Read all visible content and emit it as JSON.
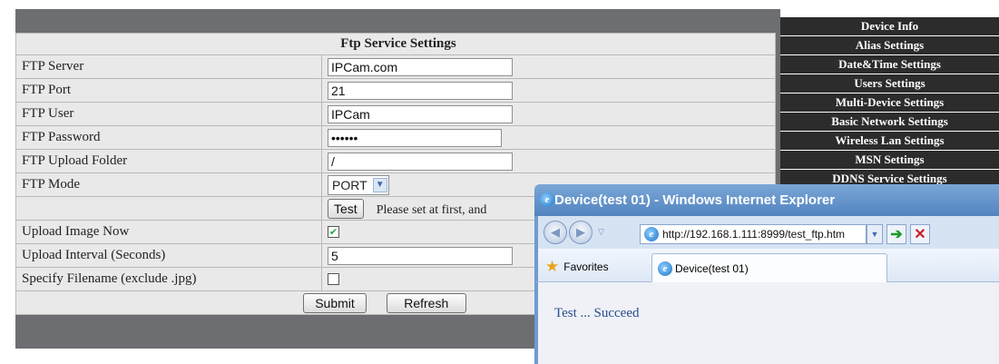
{
  "ftp_settings": {
    "title": "Ftp Service Settings",
    "fields": {
      "server": {
        "label": "FTP Server",
        "value": "IPCam.com"
      },
      "port": {
        "label": "FTP Port",
        "value": "21"
      },
      "user": {
        "label": "FTP User",
        "value": "IPCam"
      },
      "password": {
        "label": "FTP Password",
        "value": "••••••"
      },
      "upload_folder": {
        "label": "FTP Upload Folder",
        "value": "/"
      },
      "mode": {
        "label": "FTP Mode",
        "value": "PORT"
      },
      "test": {
        "button_label": "Test",
        "note": "Please set at first, and"
      },
      "upload_now": {
        "label": "Upload Image Now",
        "checked": true
      },
      "interval": {
        "label": "Upload Interval (Seconds)",
        "value": "5"
      },
      "filename": {
        "label": "Specify Filename (exclude .jpg)",
        "checked": false
      }
    },
    "submit_label": "Submit",
    "refresh_label": "Refresh"
  },
  "menu": {
    "items": [
      "Device Info",
      "Alias Settings",
      "Date&Time Settings",
      "Users Settings",
      "Multi-Device Settings",
      "Basic Network Settings",
      "Wireless Lan Settings",
      "MSN Settings",
      "DDNS Service Settings"
    ]
  },
  "popup": {
    "title": "Device(test 01) - Windows Internet Explorer",
    "address": "http://192.168.1.111:8999/test_ftp.htm",
    "favorites_label": "Favorites",
    "tab_label": "Device(test 01)",
    "result_text": "Test ... Succeed"
  },
  "colors": {
    "page_background": "#6d6e71",
    "table_background": "#e9e9e9",
    "menu_background": "#2c2c2c",
    "ie_titlebar": "#5284c0"
  },
  "icons": {
    "ie_logo": "ie-logo-icon",
    "back": "back-icon",
    "forward": "forward-icon",
    "go": "go-arrow-icon",
    "stop": "stop-icon",
    "favorites": "favorites-star-icon"
  }
}
